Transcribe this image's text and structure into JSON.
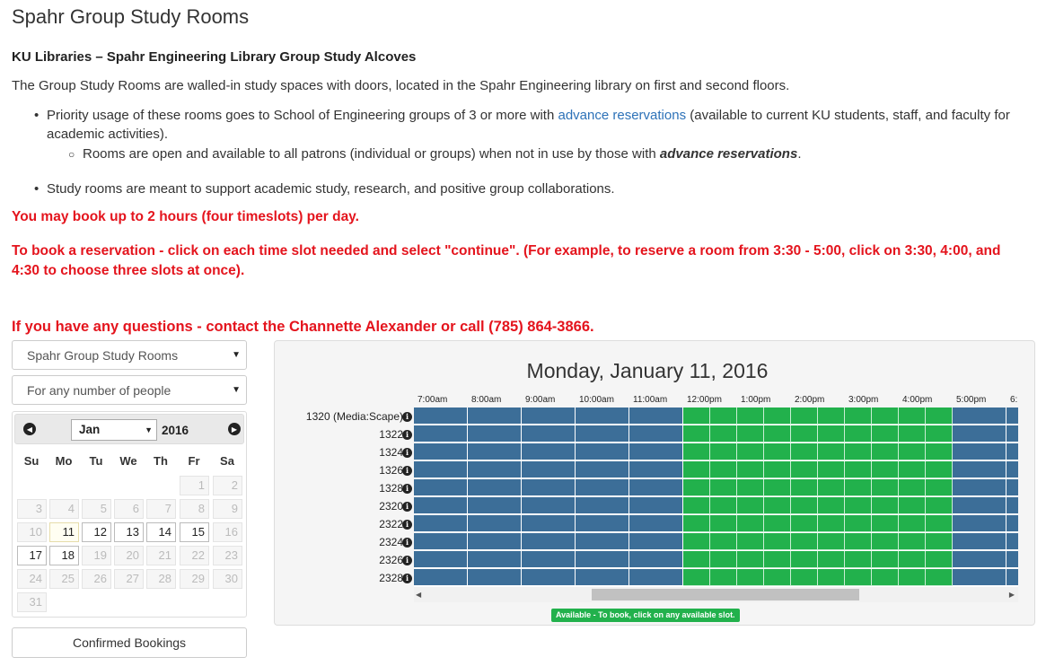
{
  "page": {
    "title": "Spahr Group Study Rooms",
    "subtitle": "KU Libraries – Spahr Engineering Library Group Study Alcoves",
    "intro": "The Group Study Rooms are walled-in study spaces with doors, located in the Spahr Engineering library on first and second floors."
  },
  "bullets": {
    "b1_pre": "Priority usage of these rooms goes to School of Engineering groups of 3 or more with ",
    "b1_link": "advance reservations",
    "b1_post": " (available to current KU students, staff, and faculty for academic activities).",
    "b1_sub_pre": "Rooms are open and available to all patrons (individual or groups) when not in use by those with ",
    "b1_sub_em": "advance reservations",
    "b1_sub_post": ".",
    "b2": "Study rooms are meant to support academic study, research, and positive group collaborations."
  },
  "notices": {
    "limit": "You may book up to 2 hours (four timeslots) per day.",
    "howto": "To book a reservation - click on each time slot needed and select \"continue\".  (For example, to reserve a room from 3:30 - 5:00, click on 3:30, 4:00, and 4:30 to choose three slots at once).",
    "contact": "If you have any questions - contact the Channette Alexander or call (785) 864-3866."
  },
  "filters": {
    "room": "Spahr Group Study Rooms",
    "people": "For any number of people"
  },
  "calendar": {
    "month": "Jan",
    "year": "2016",
    "prev_icon": "chevron-left-icon",
    "next_icon": "chevron-right-icon",
    "weekdays": [
      "Su",
      "Mo",
      "Tu",
      "We",
      "Th",
      "Fr",
      "Sa"
    ],
    "weeks": [
      [
        null,
        null,
        null,
        null,
        null,
        {
          "d": "1",
          "on": false
        },
        {
          "d": "2",
          "on": false
        }
      ],
      [
        {
          "d": "3",
          "on": false
        },
        {
          "d": "4",
          "on": false
        },
        {
          "d": "5",
          "on": false
        },
        {
          "d": "6",
          "on": false
        },
        {
          "d": "7",
          "on": false
        },
        {
          "d": "8",
          "on": false
        },
        {
          "d": "9",
          "on": false
        }
      ],
      [
        {
          "d": "10",
          "on": false
        },
        {
          "d": "11",
          "on": true,
          "today": true
        },
        {
          "d": "12",
          "on": true
        },
        {
          "d": "13",
          "on": true
        },
        {
          "d": "14",
          "on": true
        },
        {
          "d": "15",
          "on": true
        },
        {
          "d": "16",
          "on": false
        }
      ],
      [
        {
          "d": "17",
          "on": true
        },
        {
          "d": "18",
          "on": true
        },
        {
          "d": "19",
          "on": false
        },
        {
          "d": "20",
          "on": false
        },
        {
          "d": "21",
          "on": false
        },
        {
          "d": "22",
          "on": false
        },
        {
          "d": "23",
          "on": false
        }
      ],
      [
        {
          "d": "24",
          "on": false
        },
        {
          "d": "25",
          "on": false
        },
        {
          "d": "26",
          "on": false
        },
        {
          "d": "27",
          "on": false
        },
        {
          "d": "28",
          "on": false
        },
        {
          "d": "29",
          "on": false
        },
        {
          "d": "30",
          "on": false
        }
      ],
      [
        {
          "d": "31",
          "on": false
        },
        null,
        null,
        null,
        null,
        null,
        null
      ]
    ]
  },
  "confirmed_label": "Confirmed Bookings",
  "grid": {
    "date_title": "Monday, January 11, 2016",
    "time_labels": [
      "7:00am",
      "8:00am",
      "9:00am",
      "10:00am",
      "11:00am",
      "12:00pm",
      "1:00pm",
      "2:00pm",
      "3:00pm",
      "4:00pm",
      "5:00pm",
      "6:"
    ],
    "rooms": [
      "1320 (Media:Scape)",
      "1322",
      "1324",
      "1326",
      "1328",
      "2320",
      "2322",
      "2324",
      "2326",
      "2328"
    ],
    "info_icon": "info-icon",
    "slot_states": [
      "booked-hour",
      "booked-hour",
      "booked-hour",
      "booked-hour",
      "booked-hour",
      "available",
      "available",
      "available",
      "available",
      "available",
      "available",
      "available",
      "available",
      "available",
      "available",
      "booked-hour",
      "booked-hour"
    ],
    "legend_available": "Available - To book, click on any available slot.",
    "colors": {
      "booked": "#3c6e98",
      "available": "#22b14c"
    }
  }
}
